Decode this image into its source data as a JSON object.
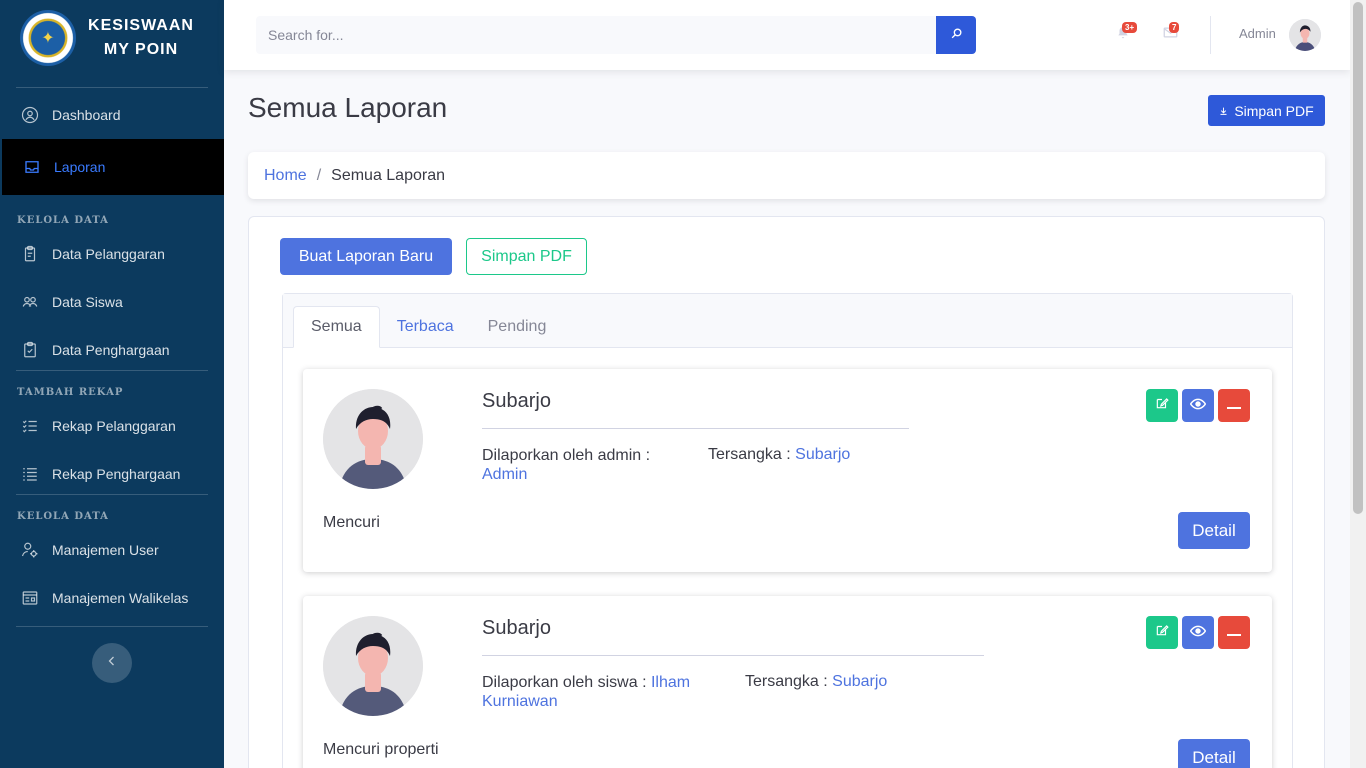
{
  "brand": {
    "line1": "KESISWAAN",
    "line2": "MY POIN"
  },
  "sidebar": {
    "items": [
      {
        "label": "Dashboard",
        "icon": "user-circle-icon"
      },
      {
        "label": "Laporan",
        "icon": "inbox-icon",
        "active": true
      }
    ],
    "section1": {
      "heading": "KELOLA DATA",
      "items": [
        {
          "label": "Data Pelanggaran",
          "icon": "clipboard-copy-icon"
        },
        {
          "label": "Data Siswa",
          "icon": "users-icon"
        },
        {
          "label": "Data Penghargaan",
          "icon": "clipboard-check-icon"
        }
      ]
    },
    "section2": {
      "heading": "TAMBAH REKAP",
      "items": [
        {
          "label": "Rekap Pelanggaran",
          "icon": "checklist-icon"
        },
        {
          "label": "Rekap Penghargaan",
          "icon": "list-icon"
        }
      ]
    },
    "section3": {
      "heading": "KELOLA DATA",
      "items": [
        {
          "label": "Manajemen User",
          "icon": "user-settings-icon"
        },
        {
          "label": "Manajemen Walikelas",
          "icon": "id-card-icon"
        }
      ]
    }
  },
  "topbar": {
    "search_placeholder": "Search for...",
    "alerts_badge": "3+",
    "messages_badge": "7",
    "user_name": "Admin"
  },
  "page": {
    "title": "Semua Laporan",
    "save_pdf_top": "Simpan PDF",
    "breadcrumb_home": "Home",
    "breadcrumb_sep": "/",
    "breadcrumb_current": "Semua Laporan",
    "btn_new": "Buat Laporan Baru",
    "btn_pdf": "Simpan PDF",
    "tabs": [
      {
        "label": "Semua"
      },
      {
        "label": "Terbaca"
      },
      {
        "label": "Pending"
      }
    ]
  },
  "reports": [
    {
      "name": "Subarjo",
      "reported_by_label": "Dilaporkan oleh admin :",
      "reporter": "Admin",
      "suspect_label": "Tersangka :",
      "suspect": "Subarjo",
      "description": "Mencuri",
      "detail_label": "Detail"
    },
    {
      "name": "Subarjo",
      "reported_by_label": "Dilaporkan oleh siswa :",
      "reporter": "Ilham Kurniawan",
      "suspect_label": "Tersangka :",
      "suspect": "Subarjo",
      "description": "Mencuri properti",
      "detail_label": "Detail"
    }
  ],
  "colors": {
    "sidebar_bg": "#0c3a5e",
    "primary": "#4e73df",
    "success": "#1cc88a",
    "danger": "#e74a3b"
  }
}
